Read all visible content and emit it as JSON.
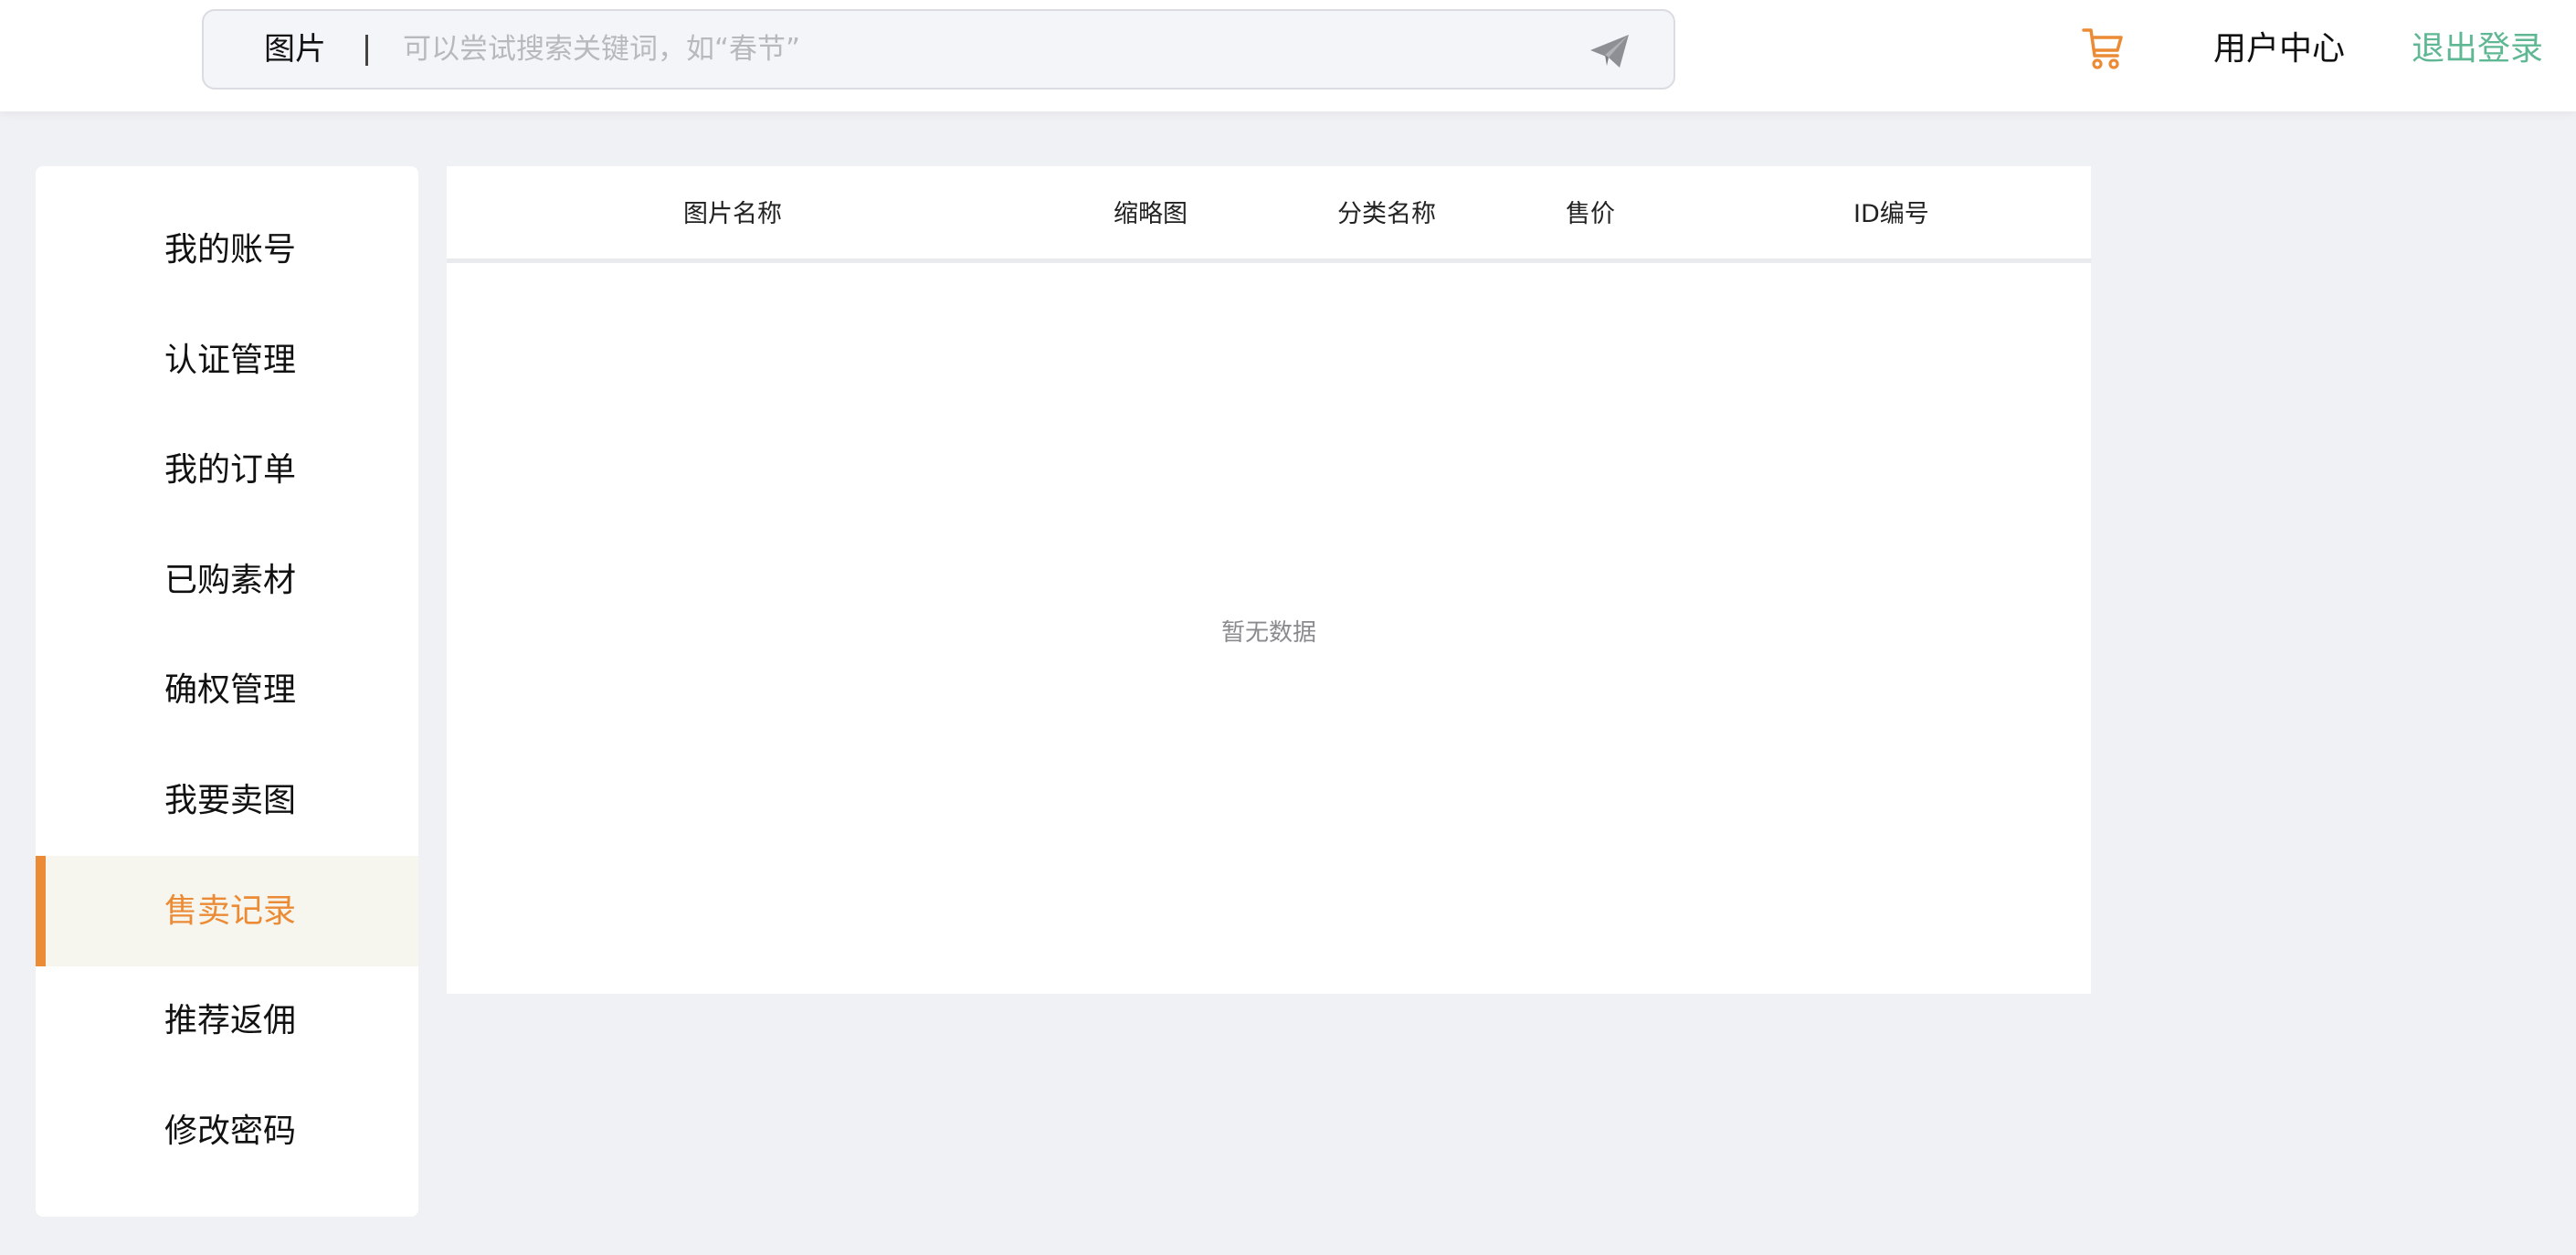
{
  "header": {
    "search": {
      "type_label": "图片",
      "placeholder": "可以尝试搜索关键词，如“春节”",
      "value": ""
    },
    "cart_icon": "cart-icon",
    "send_icon": "paper-plane-icon",
    "user_center": "用户中心",
    "logout": "退出登录",
    "colors": {
      "accent": "#ec8b35",
      "logout": "#5fb893"
    }
  },
  "sidebar": {
    "items": [
      {
        "label": "我的账号"
      },
      {
        "label": "认证管理"
      },
      {
        "label": "我的订单"
      },
      {
        "label": "已购素材"
      },
      {
        "label": "确权管理"
      },
      {
        "label": "我要卖图"
      },
      {
        "label": "售卖记录",
        "active": true
      },
      {
        "label": "推荐返佣"
      },
      {
        "label": "修改密码"
      }
    ]
  },
  "table": {
    "columns": [
      "图片名称",
      "缩略图",
      "分类名称",
      "售价",
      "ID编号"
    ],
    "rows": [],
    "empty_text": "暂无数据"
  }
}
